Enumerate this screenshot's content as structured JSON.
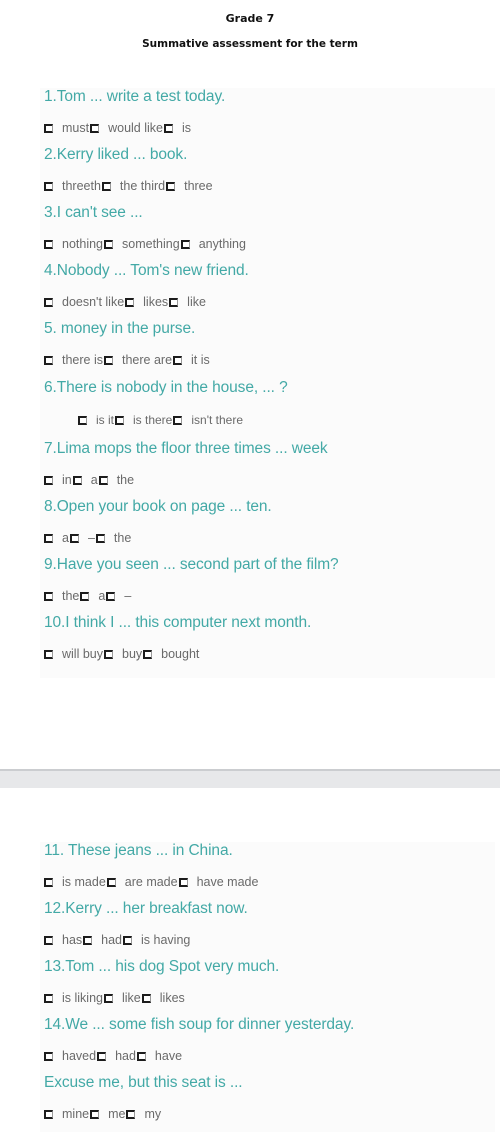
{
  "document": {
    "grade": "Grade 7",
    "subtitle": "Summative assessment for the term"
  },
  "colors": {
    "question": "#43a9a6",
    "option_text": "#6a6a6a",
    "checkbox_border": "#1c1c1c",
    "page_divider": "#e7e8ea"
  },
  "checkbox_icon": "empty-checkbox-glyph",
  "questions": [
    {
      "text": "1.Tom ... write a test today.",
      "options": [
        "must",
        "would like",
        "is"
      ]
    },
    {
      "text": "2.Kerry liked ... book.",
      "options": [
        "threeth",
        "the third",
        "three"
      ]
    },
    {
      "text": "3.I can't see ...",
      "options": [
        "nothing",
        "something",
        "anything"
      ]
    },
    {
      "text": "4.Nobody ... Tom's new friend.",
      "options": [
        "doesn't like",
        "likes",
        "like"
      ]
    },
    {
      "text": "5. money in the purse.",
      "options": [
        "there is",
        "there are",
        "it is"
      ]
    },
    {
      "text": "6.There is nobody in the house, ... ?",
      "options": [
        "is it",
        "is there",
        "isn't there"
      ]
    },
    {
      "text": "7.Lima mops the floor three times ... week",
      "options": [
        "in",
        "a",
        "the"
      ]
    },
    {
      "text": "8.Open your book on page ... ten.",
      "options": [
        "a",
        "–",
        "the"
      ]
    },
    {
      "text": "9.Have you seen ... second part of the film?",
      "options": [
        "the",
        "a",
        "–"
      ]
    },
    {
      "text": "10.I think I ... this computer next month.",
      "options": [
        "will buy",
        "buy",
        "bought"
      ]
    },
    {
      "text": "11. These jeans ... in China.",
      "options": [
        "is made",
        "are made",
        "have made"
      ]
    },
    {
      "text": "12.Kerry ... her breakfast now.",
      "options": [
        "has",
        "had",
        "is having"
      ]
    },
    {
      "text": "13.Tom ... his dog Spot very much.",
      "options": [
        "is liking",
        "like",
        "likes"
      ]
    },
    {
      "text": "14.We ... some fish soup for dinner yesterday.",
      "options": [
        "haved",
        "had",
        "have"
      ]
    },
    {
      "text": "Excuse me, but this seat is ...",
      "options": [
        "mine",
        "me",
        "my"
      ]
    }
  ]
}
